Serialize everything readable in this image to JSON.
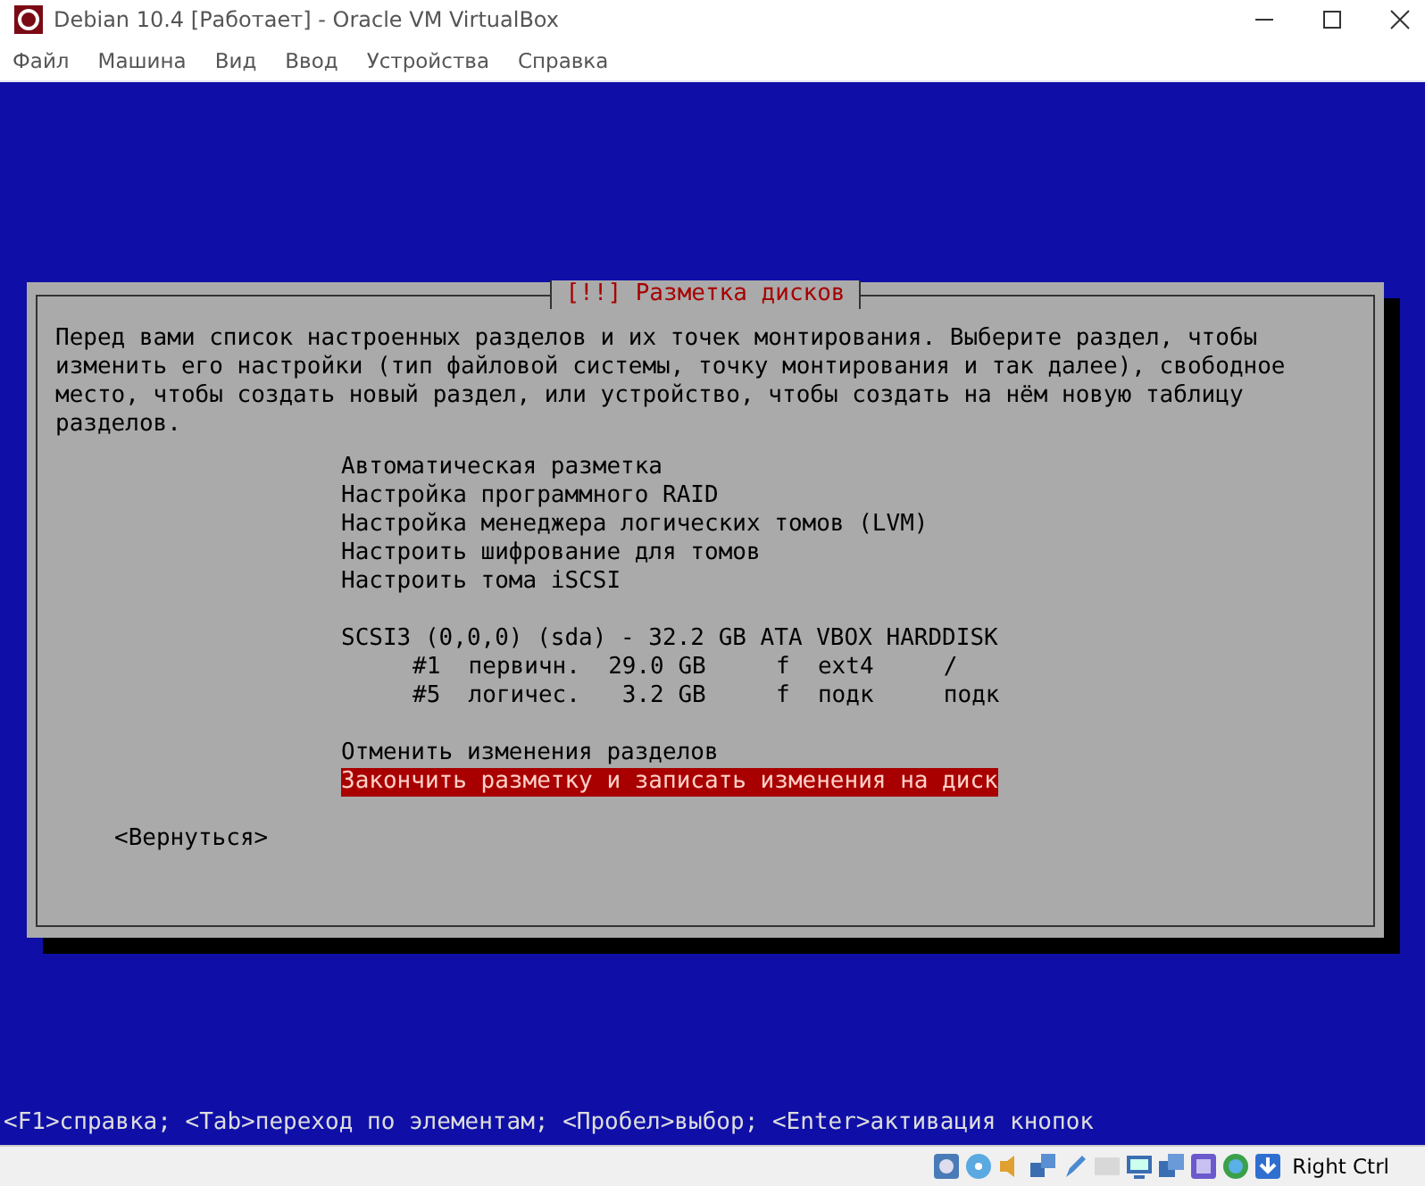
{
  "window": {
    "title": "Debian 10.4 [Работает] - Oracle VM VirtualBox"
  },
  "menu": [
    "Файл",
    "Машина",
    "Вид",
    "Ввод",
    "Устройства",
    "Справка"
  ],
  "dialog": {
    "title": "[!!] Разметка дисков",
    "description": "Перед вами список настроенных разделов и их точек монтирования. Выберите раздел, чтобы изменить его настройки (тип файловой системы, точку монтирования и так далее), свободное место, чтобы создать новый раздел, или устройство, чтобы создать на нём новую таблицу разделов.",
    "groups": [
      [
        {
          "kind": "action",
          "text": "Автоматическая разметка",
          "selected": false
        },
        {
          "kind": "action",
          "text": "Настройка программного RAID",
          "selected": false
        },
        {
          "kind": "action",
          "text": "Настройка менеджера логических томов (LVM)",
          "selected": false
        },
        {
          "kind": "action",
          "text": "Настроить шифрование для томов",
          "selected": false
        },
        {
          "kind": "action",
          "text": "Настроить тома iSCSI",
          "selected": false
        }
      ],
      [
        {
          "kind": "disk",
          "text": "SCSI3 (0,0,0) (sda) - 32.2 GB ATA VBOX HARDDISK",
          "selected": false
        },
        {
          "kind": "partition",
          "text": "#1  первичн.  29.0 GB     f  ext4     /",
          "selected": false
        },
        {
          "kind": "partition",
          "text": "#5  логичес.   3.2 GB     f  подк     подк",
          "selected": false
        }
      ],
      [
        {
          "kind": "action",
          "text": "Отменить изменения разделов",
          "selected": false
        },
        {
          "kind": "action",
          "text": "Закончить разметку и записать изменения на диск",
          "selected": true
        }
      ]
    ],
    "back_button": "<Вернуться>"
  },
  "help_line": "<F1>справка; <Tab>переход по элементам; <Пробел>выбор; <Enter>активация кнопок",
  "status_bar": {
    "host_key": "Right Ctrl"
  }
}
